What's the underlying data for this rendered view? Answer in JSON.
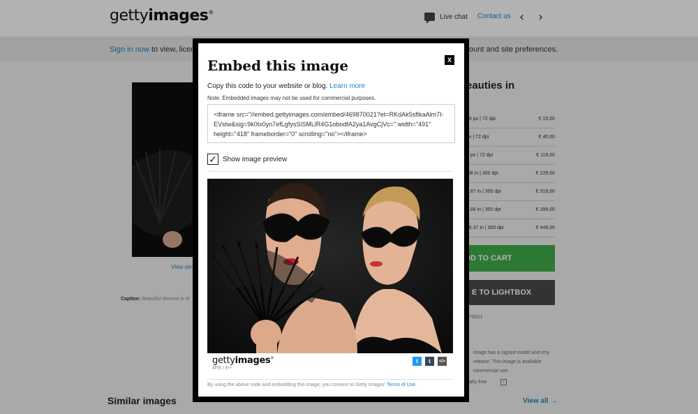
{
  "header": {
    "logo_light": "getty",
    "logo_bold": "images",
    "logo_mark": "®",
    "live_chat": "Live chat",
    "contact": "Contact us",
    "prev": "‹",
    "next": "›"
  },
  "signbar": {
    "signin_link": "Sign in now",
    "signin_rest": "to view, licens",
    "prefs_text": "ount and site preferences."
  },
  "background": {
    "view_similar": "View sim",
    "caption_label": "Caption:",
    "caption_text": "Beautiful Women in M",
    "right_title": "eauties in",
    "sizes": [
      {
        "dim": "99 px",
        "dpi": "72 dpi",
        "price": "€ 15,00"
      },
      {
        "dim": "px",
        "dpi": "72 dpi",
        "price": "€ 40,00"
      },
      {
        "dim": "9 px",
        "dpi": "72 dpi",
        "price": "€ 119,00"
      },
      {
        "dim": ".88 in",
        "dpi": "300 dpi",
        "price": "€ 229,00"
      },
      {
        "dim": "5.87 in",
        "dpi": "300 dpi",
        "price": "€ 319,00"
      },
      {
        "dim": "8.88 in",
        "dpi": "300 dpi",
        "price": "€ 399,00"
      },
      {
        "dim": "16.37 in",
        "dpi": "300 dpi",
        "price": "€ 449,00"
      }
    ],
    "add_to_cart": "DD TO CART",
    "lightbox": "E TO LIGHTBOX",
    "image_id": "70021",
    "release_text": "image has a signed model and erty release. This image is available commercial use.",
    "rf": "alty-free",
    "similar_title": "Similar images",
    "view_all": "View all"
  },
  "modal": {
    "title": "Embed this image",
    "close": "X",
    "copy_text": "Copy this code to your website or blog.",
    "learn_more": "Learn more",
    "note": "Note: Embedded images may not be used for commercial purposes.",
    "code": "<iframe src=\"//embed.gettyimages.com/embed/469870021?et=RKdAk5sftkaAlm7I-EVstw&sig=9k0tx0yn7efLgfysSiSMLlR4G1obodfA2ya1AvgCjVc=\" width=\"491\" height=\"418\" frameborder=\"0\" scrolling=\"no\"></iframe>",
    "show_preview_label": "Show image preview",
    "show_preview_checked": true,
    "footer_logo_light": "getty",
    "footer_logo_bold": "images",
    "footer_logo_mark": "®",
    "footer_sub": "4FR / E+",
    "consent_text": "By using the above code and embedding this image, you consent to Getty Images'",
    "terms_link": "Terms of Use."
  },
  "share_icons": [
    {
      "name": "twitter-icon",
      "glyph": "t",
      "color": "#1d9bf0"
    },
    {
      "name": "tumblr-icon",
      "glyph": "t",
      "color": "#35465c"
    },
    {
      "name": "embed-code-icon",
      "glyph": "</>",
      "color": "#555555"
    }
  ]
}
